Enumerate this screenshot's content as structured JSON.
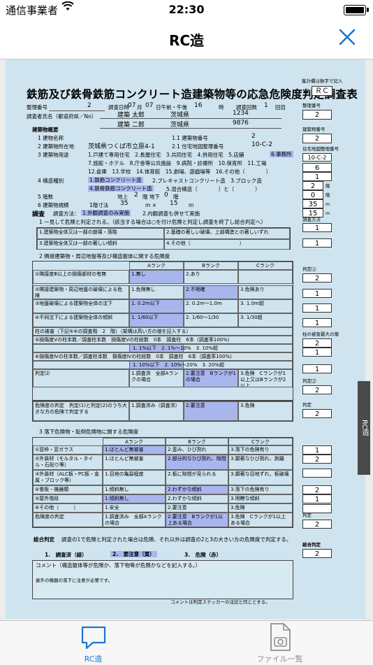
{
  "status_bar": {
    "carrier": "通信事業者",
    "time": "22:30"
  },
  "nav": {
    "title": "RC造"
  },
  "form": {
    "title": "鉄筋及び鉄骨鉄筋コンクリート造建築物等の応急危険度判定調査表",
    "header": {
      "seiri_label": "整理番号",
      "seiri_value": "2",
      "date_label": "調査日時",
      "month": "07",
      "month_unit": "月",
      "day": "07",
      "day_unit": "日午前・午後",
      "hour": "16",
      "hour_unit": "時",
      "count_label": "調査回数",
      "count": "1",
      "count_unit": "回目",
      "inspector_label": "調査者氏名（都道府県／No）",
      "inspector1_name": "建築 太郎",
      "inspector1_pref": "茨城県",
      "inspector1_no": "1234",
      "inspector2_name": "建築 二郎",
      "inspector2_pref": "茨城県",
      "inspector2_no": "9876"
    },
    "building": {
      "section": "建築物概要",
      "r1": "1 建物名称",
      "r1b": "1.1 建築物番号",
      "r1b_val": "2",
      "r2": "2 建築物所在地",
      "r2_val": "茨城県つくば市立原4-1",
      "r2b": "2.1 住宅地図整理番号",
      "r2b_val": "10-C-2",
      "r3": "3 建築物用途",
      "r3_opts": "1.戸建て専用住宅　2.長屋住宅　3.共同住宅　4.併用住宅　5.店舗",
      "r3_sel": "6.事務所",
      "r3_opts2": "7.旅館・ホテル　8.庁舎等公共施設　9.病院・診療所　10.保育所　11.工場",
      "r3_opts3": "12.倉庫　13.学校　14.体育館　15.劇場、遊戯場等　16.その他（　　　　）",
      "r4": "4 構造種別",
      "r4_sel1": "1.鉄筋コンクリート造",
      "r4_opt2": "2.プレキャストコンクリート造　3.ブロック造",
      "r4_sel2": "4.鉄骨鉄筋コンクリート造",
      "r4_opt5": "5.混合構造（　　　　）と（　　　　）",
      "r5": "5 階数",
      "r5_above": "地上",
      "r5_above_val": "2",
      "r5_above_unit": "階 地下",
      "r5_below_val": "0",
      "r5_below_unit": "階",
      "r6": "6 建築物規模",
      "r6_text": "1階寸法",
      "r6_w": "35",
      "r6_mid": "m ×",
      "r6_d": "15",
      "r6_unit": "m"
    },
    "survey": {
      "label": "調査",
      "method_label": "調査方法：",
      "method_sel": "1.外観調査のみ実施",
      "method_opt": "2.内観調査も併せて実施",
      "sec1": "1 一見して危険と判定される。（該当する場合は○を付け危険と判定し調査を終了し総合判定へ）",
      "q1_1": "1.建築物全体又は一部の崩壊・落階",
      "q1_2": "2.基礎の著しい破壊、上部構造との著しいずれ",
      "q1_3": "3.建築物全体又は一部の著しい傾斜",
      "q1_4": "4.その他（　　　　　　　　　　）",
      "sec2": "2 隣接建築物・周辺地盤等及び構造躯体に関する危険度",
      "rank_a": "Aランク",
      "rank_b": "Bランク",
      "rank_c": "Cランク",
      "r2_1": "①隣接度Ⅲ以上の損傷部材の有無",
      "r2_1a": "1.無し",
      "r2_1b": "2.あり",
      "r2_2": "②隣接建築物・周辺地盤の破壊による危険",
      "r2_2a": "1.危険無し",
      "r2_2b": "2.不明確",
      "r2_2c": "3.危険あり",
      "r2_3": "③地盤破壊による建築物全体の沈下",
      "r2_3a": "1. 0.2m以下",
      "r2_3b": "2. 0.2m～1.0m",
      "r2_3c": "3. 1.0m超",
      "r2_4": "④不同沈下による建築物全体の傾斜",
      "r2_4a": "1. 1/60以下",
      "r2_4b": "2. 1/60～1/30",
      "r2_4c": "3. 1/30超",
      "r2_5": "柱の被害（下記⑤⑥の調査階　2　階）（架構は高い方の値を記入する）",
      "r2_5a": "⑤損傷度Ⅴの柱本数／調査柱本数　損傷度Ⅴの柱総数　0本　調査柱　6本（調査率100%）",
      "r2_5b": "1. 1%以下　2. 1%～10%　3. 10%超",
      "r2_6a": "⑥損傷度Ⅳの柱本数／調査柱本数　損傷度Ⅳの柱総数　0本　調査柱　6本（調査率100%）",
      "r2_6b": "1. 10%以下　2. 10%～20%　3. 20%超",
      "judge2": "判定⑵",
      "j2a": "1.調査済　全部Aランクの場合",
      "j2b": "2.要注意　Bランクが1の場合",
      "j2c": "3.危険　Cランクが1以上又はBランクが2以上",
      "danger_label": "危険度の判定　判定(1)と判定(2)のうち大きな方の危険で判定する",
      "dj1": "1.調査済み（調査済）",
      "dj2": "2.要注意",
      "dj3": "3.危険",
      "sec3": "3 落下危険物・転倒危険物に関する危険度",
      "f1": "①窓枠・窓ガラス",
      "f1a": "1.ほとんど無被害",
      "f1b": "2.歪み、ひび割れ",
      "f1c": "3.落下の危険有り",
      "f2": "②外装材（モルタル・タイル・石貼り等）",
      "f2a": "1.ほとんど無被害",
      "f2b": "2.部分的なひび割れ、隙間",
      "f2c": "3.顕著なひび割れ、剥離",
      "f3": "③外装材（ALC板・PC板・金属・ブロック等）",
      "f3a": "1.目地の亀裂程度",
      "f3b": "2.板に隙間が見られる",
      "f3c": "3.顕著な目地ずれ、板破壊",
      "f4": "④看板・機器類",
      "f4a": "1.傾斜無し",
      "f4b": "2.わずかな傾斜",
      "f4c": "3.落下の危険有り",
      "f5": "⑤屋外階段",
      "f5a": "1.傾斜無し",
      "f5b": "2.わずかな傾斜",
      "f5c": "3.明瞭な傾斜",
      "f6": "⑥その他（　　　）",
      "f6a": "1.安全",
      "f6b": "2.要注意",
      "f6c": "3.危険",
      "fj": "危険度の判定",
      "fja": "1.調査済み　全部Aランクの場合",
      "fjb": "2.要注意　Bランクが1以上ある場合",
      "fjc": "3.危険　Cランクが1以上ある場合"
    },
    "overall": {
      "label": "総合判定",
      "text": "調査の1で危険と判定された場合は危険、それ以外は調査の2と3の大きい方の危険度で判定する。",
      "opt1": "1.　調査済（緑）",
      "opt2": "2.　要注意（黄）",
      "opt3": "3.　危険（赤）",
      "comment_label": "コメント（構造躯体等が危険か、落下物等が危険かなどを記入する。）",
      "comment": "屋外の機器の落下に注意が必要です。",
      "footer": "コメントは判定ステッカーの注記と同じとする。"
    },
    "right_col": {
      "note": "集計欄は数字で記入",
      "rc": "ＲＣ",
      "seiri_label": "整理番号",
      "seiri_val": "2",
      "bno_label": "建築物番号",
      "bno_val": "2",
      "map_label": "住宅地図整理番号",
      "map_val": "10-C-2",
      "n3": "6",
      "n4": "1",
      "n_above": "2",
      "n_above_unit": "階",
      "n_below": "0",
      "n_below_unit": "階",
      "w": "35",
      "w_unit": "m",
      "d": "15",
      "d_unit": "m",
      "method_label": "調査方法",
      "method_val": "1",
      "s1_val": "1",
      "j1_label": "判定⑴",
      "j1_val": "2",
      "v2": "1",
      "v3": "1",
      "v4": "1",
      "pillar_label": "柱の被害最大の階",
      "pillar_val": "2",
      "v5": "1",
      "v6": "1",
      "j2_label": "判定⑵",
      "j2_val": "2",
      "judge_label": "判定",
      "judge_val": "2",
      "f1v": "1",
      "f2v": "2",
      "f3v": "",
      "f4v": "2",
      "f5v": "1",
      "f6v": "",
      "fj_label": "判定",
      "fj_val": "2",
      "overall_label": "総合判定",
      "overall_val": "2"
    },
    "side_tab": "RC造"
  },
  "tabs": [
    {
      "label": "RC造"
    },
    {
      "label": "ファイル一覧"
    }
  ],
  "colors": {
    "accent": "#1a75d2",
    "highlight": "#a9b6ee",
    "paper": "#cfe4ee"
  }
}
